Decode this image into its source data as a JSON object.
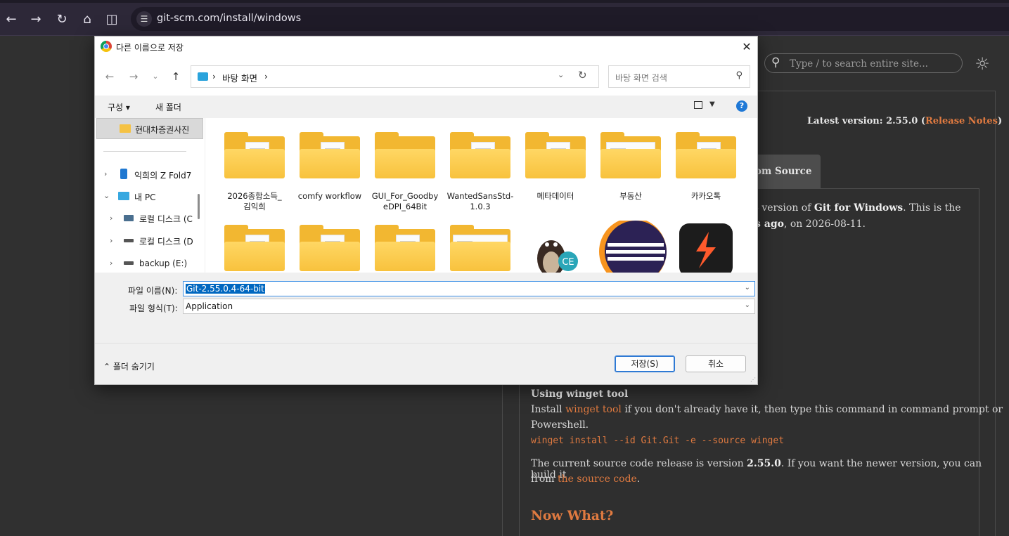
{
  "browser": {
    "url": "git-scm.com/install/windows"
  },
  "site": {
    "search_placeholder": "Type / to search entire site...",
    "latest_prefix": "Latest version: 2.55.0 (",
    "latest_link": "Release Notes",
    "latest_suffix": ")",
    "source_tab": "om Source",
    "para1_line1_a": "4 version of ",
    "para1_line1_b": "Git for Windows",
    "para1_line1_c": ". This is the",
    "para1_line2_a": "s ago",
    "para1_line2_b": ", on 2026-08-11.",
    "winget_title": "Using winget tool",
    "winget_l1_a": "Install ",
    "winget_l1_link": "winget tool",
    "winget_l1_b": " if you don't already have it, then type this command in command prompt or",
    "winget_l2": "Powershell.",
    "winget_cmd": "winget install --id Git.Git -e --source winget",
    "source_l1_a": "The current source code release is version ",
    "source_l1_b": "2.55.0",
    "source_l1_c": ". If you want the newer version, you can build it",
    "source_l2_a": "from ",
    "source_l2_link": "the source code",
    "source_l2_b": ".",
    "now_what": "Now What?"
  },
  "dialog": {
    "title": "다른 이름으로 저장",
    "address": {
      "crumb_sep": "›",
      "location": "바탕 화면"
    },
    "search_placeholder": "바탕 화면 검색",
    "commands": {
      "organize": "구성 ▾",
      "new_folder": "새 폴더"
    },
    "sidebar": {
      "selected": "현대차증권사진",
      "items": [
        {
          "label": "익희의 Z Fold7"
        },
        {
          "label": "내 PC"
        },
        {
          "label": "로컬 디스크 (C"
        },
        {
          "label": "로컬 디스크 (D"
        },
        {
          "label": "backup (E:)"
        }
      ]
    },
    "files": [
      {
        "name_l1": "2026종합소득_",
        "name_l2": "김익희"
      },
      {
        "name_l1": "comfy workflow",
        "name_l2": ""
      },
      {
        "name_l1": "GUI_For_Goodby",
        "name_l2": "eDPI_64Bit"
      },
      {
        "name_l1": "WantedSansStd-",
        "name_l2": "1.0.3"
      },
      {
        "name_l1": "메타데이터",
        "name_l2": ""
      },
      {
        "name_l1": "부동산",
        "name_l2": ""
      },
      {
        "name_l1": "카카오톡",
        "name_l2": ""
      }
    ],
    "ce_badge": "CE",
    "filename_label": "파일 이름(N):",
    "filename_value": "Git-2.55.0.4-64-bit",
    "filetype_label": "파일 형식(T):",
    "filetype_value": "Application",
    "hide_folders": "폴더 숨기기",
    "save_button": "저장(S)",
    "cancel_button": "취소"
  },
  "colors": {
    "accent_orange": "#e07a40",
    "selection_blue": "#0067c0",
    "folder_yellow": "#f8c23d"
  }
}
